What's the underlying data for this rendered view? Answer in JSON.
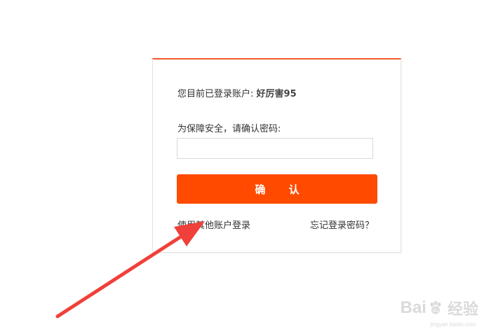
{
  "login_panel": {
    "account_prefix": "您目前已登录账户:",
    "account_name": "好厉害95",
    "password_prompt": "为保障安全，请确认密码:",
    "password_value": "",
    "password_placeholder": "",
    "confirm_label": "确 认",
    "other_account_link": "使用其他账户登录",
    "forgot_password_link": "忘记登录密码？"
  },
  "annotation": {
    "arrow_color": "#f0403a",
    "icon": "red-arrow-icon"
  },
  "watermark": {
    "brand_left": "Bai",
    "brand_right": "经验",
    "url": "jingyan.baidu.com",
    "icon": "baidu-paw-icon"
  },
  "colors": {
    "accent": "#ff4a00",
    "panel_top_border": "#f05a28"
  }
}
